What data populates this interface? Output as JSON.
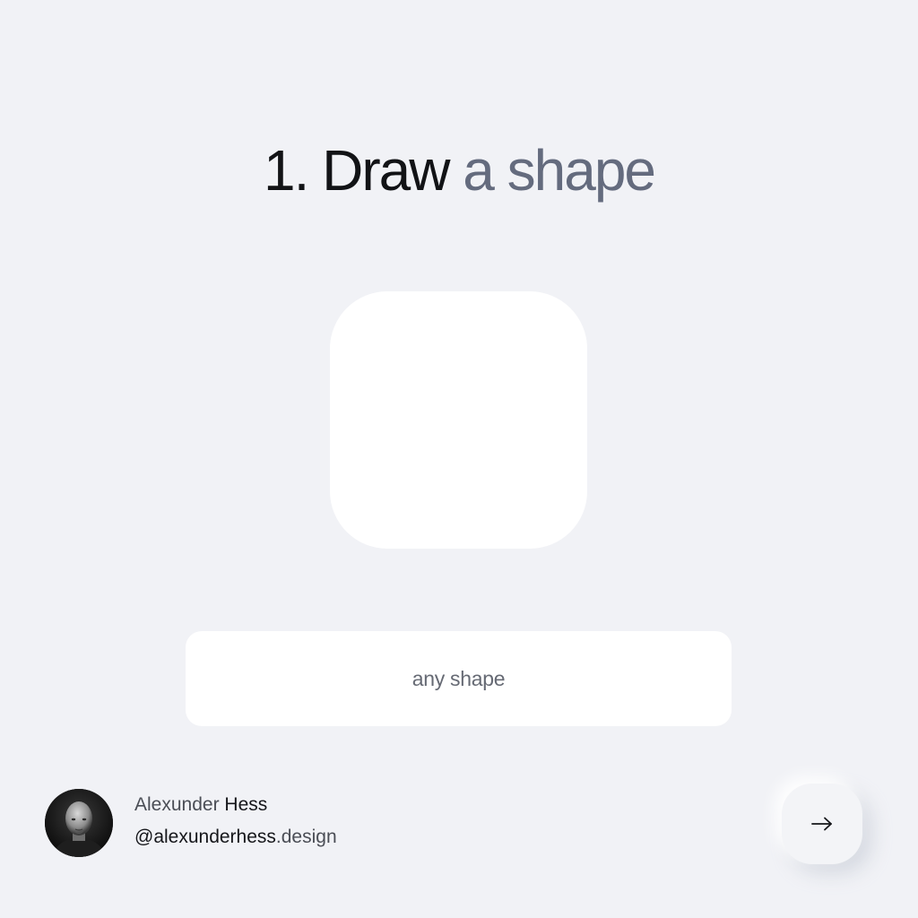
{
  "title": {
    "dark": "1. Draw",
    "muted": "a shape"
  },
  "shape": {
    "fill": "#ffffff"
  },
  "label": {
    "text": "any shape"
  },
  "author": {
    "first_name": "Alexunder",
    "last_name": "Hess",
    "handle": "@alexunderhess",
    "handle_suffix": ".design",
    "avatar_icon": "person-portrait-avatar"
  },
  "next_button": {
    "icon": "arrow-right-icon"
  },
  "colors": {
    "background": "#f1f2f6",
    "title_dark": "#121316",
    "title_muted": "#646b7e",
    "card": "#ffffff"
  }
}
